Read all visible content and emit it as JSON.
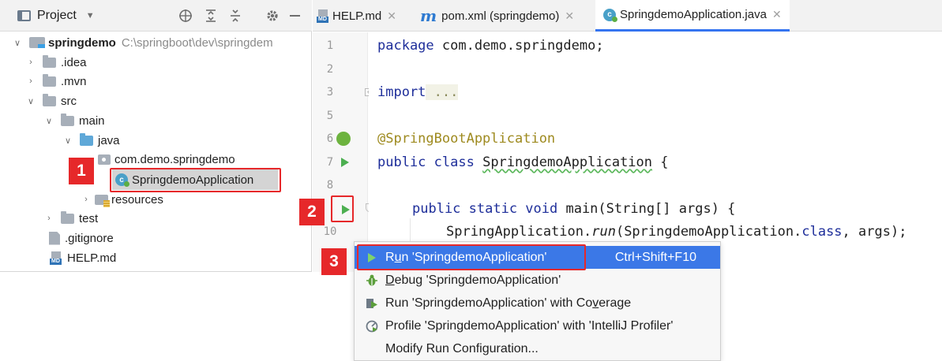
{
  "project_panel": {
    "title": "Project",
    "header_icons": [
      "target-icon",
      "expand-all-icon",
      "collapse-all-icon",
      "gear-icon",
      "hide-icon"
    ],
    "tree": {
      "root_name": "springdemo",
      "root_path": "C:\\springboot\\dev\\springdem",
      "idea": ".idea",
      "mvn": ".mvn",
      "src": "src",
      "main": "main",
      "java": "java",
      "package": "com.demo.springdemo",
      "app_class": "SpringdemoApplication",
      "resources": "resources",
      "test": "test",
      "gitignore": ".gitignore",
      "help_md": "HELP.md"
    }
  },
  "tabs": [
    {
      "label": "HELP.md",
      "icon": "markdown-icon"
    },
    {
      "label": "pom.xml (springdemo)",
      "icon": "maven-icon"
    },
    {
      "label": "SpringdemoApplication.java",
      "icon": "java-class-icon"
    }
  ],
  "editor": {
    "line_numbers": [
      "1",
      "2",
      "3",
      "5",
      "6",
      "7",
      "8",
      "10"
    ],
    "code": {
      "l1_kw": "package",
      "l1_rest": " com.demo.springdemo;",
      "l3_kw": "import",
      "l3_rest": " ...",
      "l6": "@SpringBootApplication",
      "l7_kw": "public class",
      "l7_name": "SpringdemoApplication",
      "l7_rest": " {",
      "l9_kw": "public static void",
      "l9_rest": " main(String[] args) {",
      "l10_a": "SpringApplication.",
      "l10_b": "run",
      "l10_c": "(SpringdemoApplication.",
      "l10_d": "class",
      "l10_e": ", args);"
    }
  },
  "context_menu": {
    "items": [
      {
        "label_pre": "R",
        "label_mn": "u",
        "label_post": "n 'SpringdemoApplication'",
        "shortcut": "Ctrl+Shift+F10",
        "icon": "run-icon"
      },
      {
        "label_pre": "",
        "label_mn": "D",
        "label_post": "ebug 'SpringdemoApplication'",
        "shortcut": "",
        "icon": "debug-icon"
      },
      {
        "label_pre": "Run 'SpringdemoApplication' with Co",
        "label_mn": "v",
        "label_post": "erage",
        "shortcut": "",
        "icon": "coverage-icon"
      },
      {
        "label_pre": "Profile 'SpringdemoApplication' with 'IntelliJ Profiler'",
        "label_mn": "",
        "label_post": "",
        "shortcut": "",
        "icon": "profiler-icon"
      },
      {
        "label_pre": "Modify Run Configuration...",
        "label_mn": "",
        "label_post": "",
        "shortcut": "",
        "icon": ""
      }
    ]
  },
  "annotations": {
    "badge1": "1",
    "badge2": "2",
    "badge3": "3"
  },
  "colors": {
    "accent": "#3b78e7",
    "annotation_red": "#e6282a",
    "run_green": "#4caf50"
  }
}
